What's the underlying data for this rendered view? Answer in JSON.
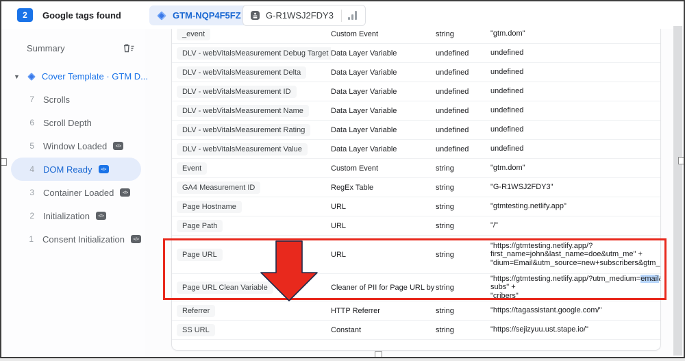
{
  "header": {
    "count": "2",
    "title": "Google tags found",
    "tabs": [
      {
        "label": "GTM-NQP4F5FZ",
        "active": true
      },
      {
        "label": "G-R1WSJ2FDY3",
        "active": false
      }
    ]
  },
  "sidebar": {
    "summary_label": "Summary",
    "container_label": "Cover Template · GTM D...",
    "events": [
      {
        "num": "7",
        "label": "Scrolls",
        "badge": false,
        "selected": false
      },
      {
        "num": "6",
        "label": "Scroll Depth",
        "badge": false,
        "selected": false
      },
      {
        "num": "5",
        "label": "Window Loaded",
        "badge": true,
        "selected": false
      },
      {
        "num": "4",
        "label": "DOM Ready",
        "badge": true,
        "selected": true
      },
      {
        "num": "3",
        "label": "Container Loaded",
        "badge": true,
        "selected": false
      },
      {
        "num": "2",
        "label": "Initialization",
        "badge": true,
        "selected": false
      },
      {
        "num": "1",
        "label": "Consent Initialization",
        "badge": true,
        "selected": false
      }
    ],
    "badge_glyph": "</>"
  },
  "table": {
    "rows": [
      {
        "name": "_event",
        "type": "Custom Event",
        "rtype": "string",
        "value_lines": [
          "\"gtm.dom\""
        ]
      },
      {
        "name": "DLV - webVitalsMeasurement Debug Target",
        "type": "Data Layer Variable",
        "rtype": "undefined",
        "value_lines": [
          "undefined"
        ]
      },
      {
        "name": "DLV - webVitalsMeasurement Delta",
        "type": "Data Layer Variable",
        "rtype": "undefined",
        "value_lines": [
          "undefined"
        ]
      },
      {
        "name": "DLV - webVitalsMeasurement ID",
        "type": "Data Layer Variable",
        "rtype": "undefined",
        "value_lines": [
          "undefined"
        ]
      },
      {
        "name": "DLV - webVitalsMeasurement Name",
        "type": "Data Layer Variable",
        "rtype": "undefined",
        "value_lines": [
          "undefined"
        ]
      },
      {
        "name": "DLV - webVitalsMeasurement Rating",
        "type": "Data Layer Variable",
        "rtype": "undefined",
        "value_lines": [
          "undefined"
        ]
      },
      {
        "name": "DLV - webVitalsMeasurement Value",
        "type": "Data Layer Variable",
        "rtype": "undefined",
        "value_lines": [
          "undefined"
        ]
      },
      {
        "name": "Event",
        "type": "Custom Event",
        "rtype": "string",
        "value_lines": [
          "\"gtm.dom\""
        ]
      },
      {
        "name": "GA4 Measurement ID",
        "type": "RegEx Table",
        "rtype": "string",
        "value_lines": [
          "\"G-R1WSJ2FDY3\""
        ]
      },
      {
        "name": "Page Hostname",
        "type": "URL",
        "rtype": "string",
        "value_lines": [
          "\"gtmtesting.netlify.app\""
        ]
      },
      {
        "name": "Page Path",
        "type": "URL",
        "rtype": "string",
        "value_lines": [
          "\"/\""
        ]
      },
      {
        "name": "Page URL",
        "type": "URL",
        "rtype": "string",
        "value_lines": [
          "\"https://gtmtesting.netlify.app/?",
          "first_name=john&last_name=doe&utm_me\" +",
          "\"dium=Email&utm_source=new+subscribers&gtm_debug="
        ]
      },
      {
        "name": "Page URL Clean Variable",
        "type": "Cleaner of PII for Page URL by",
        "rtype": "string",
        "value_lines": [
          "\"https://gtmtesting.netlify.app/?utm_medium=email&utm",
          "subs\" +",
          "\"cribers\""
        ],
        "highlight": "email"
      },
      {
        "name": "Referrer",
        "type": "HTTP Referrer",
        "rtype": "string",
        "value_lines": [
          "\"https://tagassistant.google.com/\""
        ]
      },
      {
        "name": "SS URL",
        "type": "Constant",
        "rtype": "string",
        "value_lines": [
          "\"https://sejizyuu.ust.stape.io/\""
        ]
      }
    ]
  },
  "colors": {
    "accent_blue": "#1a73e8",
    "tab_pill_bg": "#e7eefb",
    "selection_highlight": "#b9d7fc",
    "annotation_red": "#e8291d",
    "arrow_outline": "#1e2a4a"
  }
}
